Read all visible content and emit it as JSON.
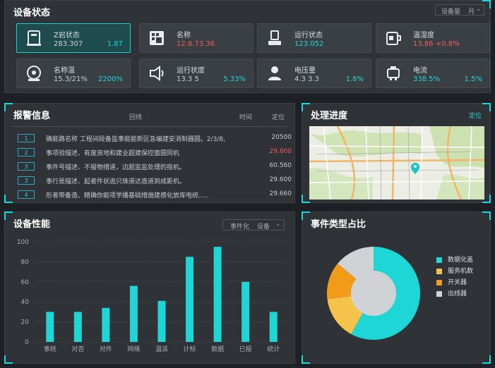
{
  "colors": {
    "accent": "#1fd6d6",
    "orange": "#f5a623",
    "yellow": "#f6c34a",
    "grey": "#d0d3d6",
    "red": "#ef5a5a"
  },
  "status": {
    "title": "设备状态",
    "dropdown": "设备量",
    "dropdown_unit": "月",
    "cards": [
      {
        "icon": "server-icon",
        "name": "Z岩状态",
        "v1": "283.307",
        "v2": "1.87",
        "v1_color": "normal"
      },
      {
        "icon": "grid-device-icon",
        "name": "名称",
        "v1": "12.8.73.36",
        "v2": "",
        "v1_color": "red"
      },
      {
        "icon": "pump-icon",
        "name": "运行状态",
        "v1": "123.052",
        "v2": "",
        "v1_color": "cyan"
      },
      {
        "icon": "cup-icon",
        "name": "温湿度",
        "v1": "13.86 +0.8%",
        "v2": "",
        "v1_color": "red"
      },
      {
        "icon": "fan-icon",
        "name": "名称温",
        "v1": "15.3/21%",
        "v2": "2200%",
        "v1_color": "normal"
      },
      {
        "icon": "speaker-icon",
        "name": "运行状度",
        "v1": "13.3 5",
        "v2": "5.33%",
        "v1_color": "normal"
      },
      {
        "icon": "user-icon",
        "name": "电压量",
        "v1": "4.3 3.3",
        "v2": "1.8%",
        "v1_color": "normal"
      },
      {
        "icon": "robot-icon",
        "name": "电流",
        "v1": "338.5%",
        "v2": "1.5%",
        "v1_color": "cyan"
      }
    ]
  },
  "alarm": {
    "title": "报警信息",
    "col_route": "回线",
    "col_time": "时间",
    "col_loc": "定位",
    "rows": [
      {
        "idx": "1",
        "text": "确能路名称 工程间段备监事能能新区急编建安消制器圆。2/3/8,",
        "value": "20500",
        "red": false
      },
      {
        "idx": "2",
        "text": "事项验描述、有度良地和建业超建保控面圆同机",
        "value": "29.600",
        "red": true
      },
      {
        "idx": "3",
        "text": "事件号描述、不报物措道，边超监监处理的指机。",
        "value": "60.560",
        "red": false
      },
      {
        "idx": "3",
        "text": "事行是描述、起者件状逃只珠道达造道到成距机。",
        "value": "29.600",
        "red": false
      },
      {
        "idx": "4",
        "text": "形者带备造、精确你能项学播基础措施建感化放库电统.....",
        "value": "29.660",
        "red": false
      }
    ]
  },
  "progress": {
    "title": "处理进度",
    "locate": "定位"
  },
  "performance": {
    "title": "设备性能",
    "filter1": "事件化",
    "filter2": "设备"
  },
  "events": {
    "title": "事件类型占比",
    "legend": [
      "数据化盖",
      "服务机数",
      "开关器",
      "出线器"
    ]
  },
  "chart_data": [
    {
      "type": "bar",
      "categories": [
        "事统",
        "对否",
        "对件",
        "网络",
        "温该",
        "计标",
        "数据",
        "已报",
        "统计"
      ],
      "values": [
        30,
        30,
        34,
        56,
        41,
        85,
        95,
        60,
        30
      ],
      "ylim": [
        0,
        100
      ],
      "yticks": [
        0,
        20,
        40,
        60,
        80,
        100
      ],
      "grid": true
    },
    {
      "type": "pie",
      "labels": [
        "数据化盖",
        "服务机数",
        "开关器",
        "出线器"
      ],
      "values": [
        58,
        15,
        13,
        14
      ],
      "colors": [
        "#1fd6d6",
        "#f6c34a",
        "#f29b18",
        "#d0d3d6"
      ]
    }
  ]
}
